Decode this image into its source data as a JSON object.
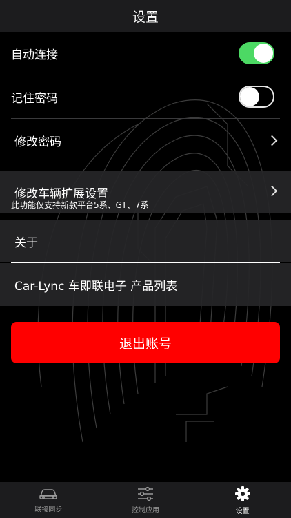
{
  "header": {
    "title": "设置"
  },
  "settings": {
    "auto_connect": {
      "label": "自动连接",
      "enabled": true
    },
    "remember_password": {
      "label": "记住密码",
      "enabled": false
    },
    "change_password": {
      "label": "修改密码"
    },
    "vehicle_ext": {
      "label": "修改车辆扩展设置",
      "note": "此功能仅支持新款平台5系、GT、7系"
    },
    "about": {
      "label": "关于"
    },
    "products": {
      "label": "Car-Lync 车即联电子 产品列表"
    }
  },
  "logout": {
    "label": "退出账号"
  },
  "tabbar": {
    "tabs": [
      {
        "label": "联接同步",
        "icon": "car-icon",
        "active": false
      },
      {
        "label": "控制应用",
        "icon": "sliders-icon",
        "active": false
      },
      {
        "label": "设置",
        "icon": "gear-icon",
        "active": true
      }
    ]
  },
  "colors": {
    "toggle_on": "#4cd964",
    "logout_button": "#ff0000",
    "inactive_tab": "#9a9a9a",
    "active_tab": "#ffffff"
  }
}
